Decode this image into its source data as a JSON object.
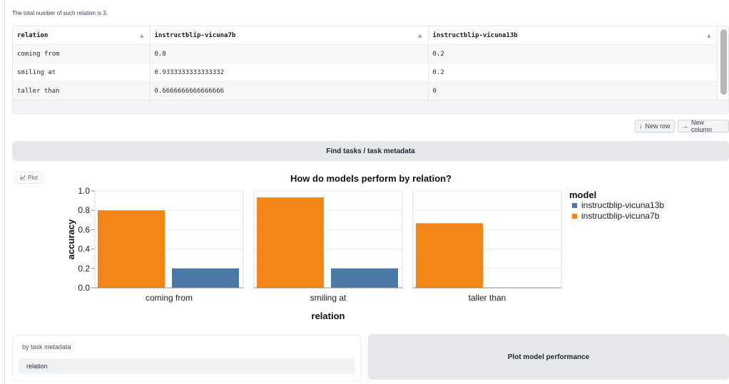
{
  "note": "The total number of such relation is 3.",
  "table": {
    "columns": [
      "relation",
      "instructblip-vicuna7b",
      "instructblip-vicuna13b"
    ],
    "rows": [
      [
        "coming from",
        "0.8",
        "0.2"
      ],
      [
        "smiling at",
        "0.9333333333333332",
        "0.2"
      ],
      [
        "taller than",
        "0.6666666666666666",
        "0"
      ]
    ]
  },
  "actions": {
    "new_row": "New row",
    "new_column": "New column",
    "find_tasks": "Find tasks / task metadata"
  },
  "plot_tag": "Plot",
  "icons": {
    "sort": "sort-arrow-icon",
    "new_row": "arrow-down-icon",
    "new_column": "arrow-right-icon",
    "plot": "chart-icon"
  },
  "chart_data": {
    "type": "bar",
    "title": "How do models perform by relation?",
    "xlabel": "relation",
    "ylabel": "accuracy",
    "categories": [
      "coming from",
      "smiling at",
      "taller than"
    ],
    "series": [
      {
        "name": "instructblip-vicuna7b",
        "values": [
          0.8,
          0.9333333333333332,
          0.6666666666666666
        ],
        "color": "#f58518"
      },
      {
        "name": "instructblip-vicuna13b",
        "values": [
          0.2,
          0.2,
          0
        ],
        "color": "#4c78a8"
      }
    ],
    "ylim": [
      0,
      1.0
    ],
    "yticks": [
      "0.0",
      "0.2",
      "0.4",
      "0.6",
      "0.8",
      "1.0"
    ],
    "legend_title": "model",
    "legend_entries": [
      "instructblip-vicuna13b",
      "instructblip-vicuna7b"
    ],
    "legend_colors": [
      "#4c78a8",
      "#f58518"
    ],
    "legend_position": "right",
    "grid": true
  },
  "metadata_panel": {
    "label": "by task metadata",
    "value": "relation"
  },
  "plot_button": "Plot model performance"
}
